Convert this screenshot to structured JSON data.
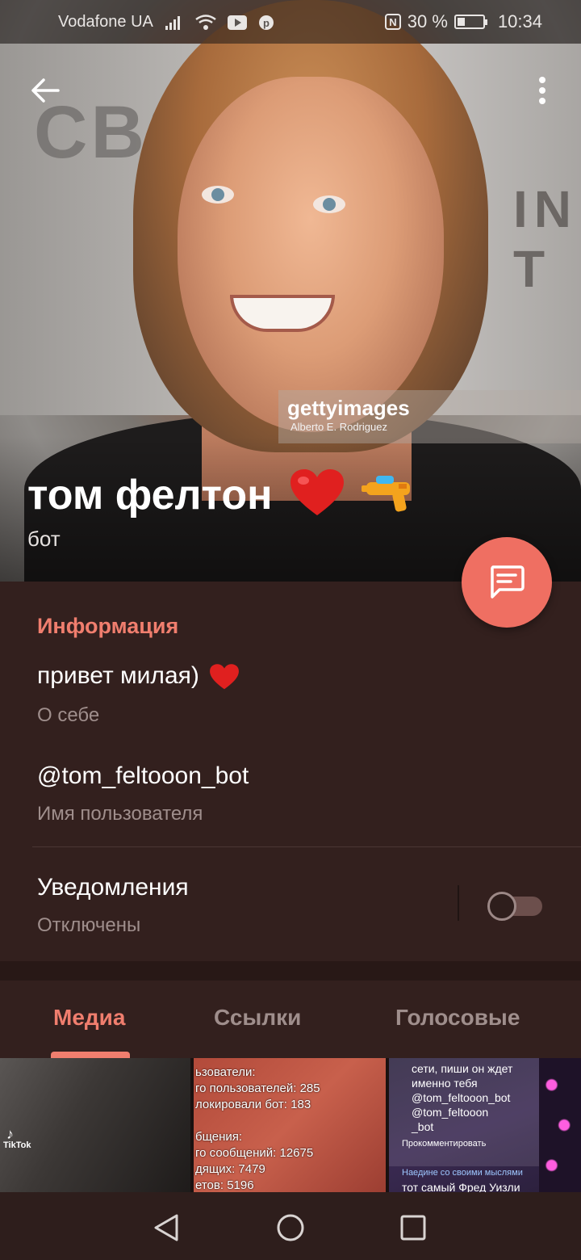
{
  "status_bar": {
    "carrier": "Vodafone UA",
    "battery": "30 %",
    "battery_level": 0.3,
    "time": "10:34"
  },
  "profile": {
    "name": "том фелтон",
    "name_emoji": [
      "heart",
      "water-pistol"
    ],
    "subtitle": "бот",
    "photo_watermark": "gettyimages",
    "photo_credit": "Alberto E. Rodriguez"
  },
  "info": {
    "section_title": "Информация",
    "bio_value": "привет милая)",
    "bio_label": "О себе",
    "username_value": "@tom_feltooon_bot",
    "username_label": "Имя пользователя",
    "notifications_title": "Уведомления",
    "notifications_status": "Отключены",
    "notifications_enabled": false
  },
  "tabs": [
    {
      "label": "Медиа",
      "active": true
    },
    {
      "label": "Ссылки",
      "active": false
    },
    {
      "label": "Голосовые",
      "active": false
    }
  ],
  "media": [
    {
      "type": "video",
      "overlay": "TikTok"
    },
    {
      "type": "image",
      "text": "ьзователи:\nго пользователей: 285\nлокировали бот: 183\n\nбщения:\nго сообщений: 12675\nдящих: 7479\nетов: 5196"
    },
    {
      "type": "image",
      "text": "сети, пиши он ждет\nименно тебя\n@tom_feltooon_bot\n@tom_feltooon\n_bot",
      "comment": "Прокомментировать",
      "footer_link": "Наедине со своими мыслями",
      "footer_text": "тот самый Фред Уизли"
    }
  ],
  "colors": {
    "accent": "#f07e6e",
    "fab": "#ef6f62",
    "background": "#33201e",
    "secondary_text": "#9f8e8c"
  },
  "icons": {
    "back": "arrow-left-icon",
    "menu": "more-vertical-icon",
    "fab": "message-icon",
    "nav_back": "triangle-back-icon",
    "nav_home": "circle-home-icon",
    "nav_recents": "square-recents-icon"
  }
}
